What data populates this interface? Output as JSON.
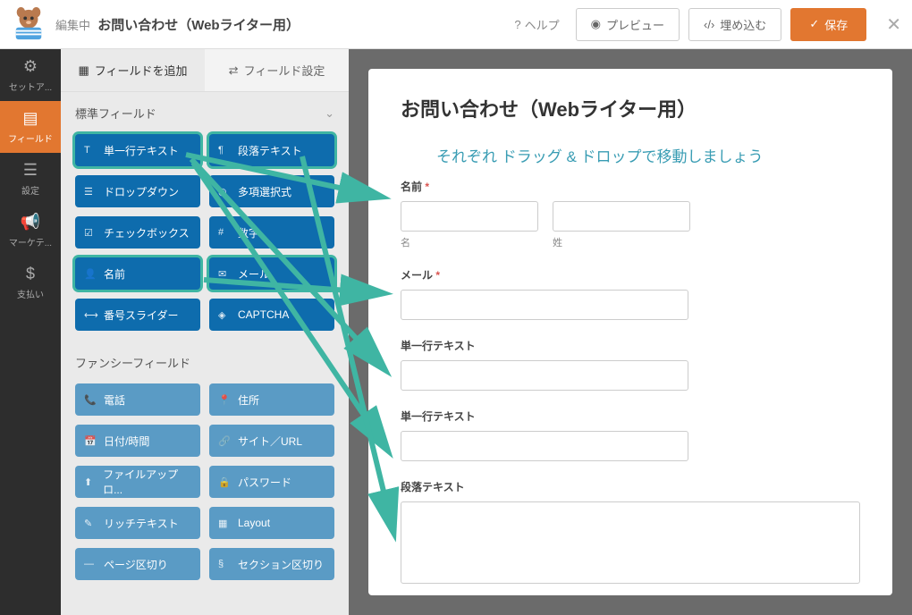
{
  "header": {
    "editing_label": "編集中",
    "form_name": "お問い合わせ（Webライター用）",
    "help": "ヘルプ",
    "preview": "プレビュー",
    "embed": "埋め込む",
    "save": "保存"
  },
  "nav": {
    "setup": "セットア...",
    "fields": "フィールド",
    "settings": "設定",
    "marketing": "マーケテ...",
    "payment": "支払い"
  },
  "panel": {
    "add_tab": "フィールドを追加",
    "settings_tab": "フィールド設定",
    "section_standard": "標準フィールド",
    "section_fancy": "ファンシーフィールド",
    "fields_standard": [
      {
        "label": "単一行テキスト",
        "highlighted": true
      },
      {
        "label": "段落テキスト",
        "highlighted": true
      },
      {
        "label": "ドロップダウン",
        "highlighted": false
      },
      {
        "label": "多項選択式",
        "highlighted": false
      },
      {
        "label": "チェックボックス",
        "highlighted": false
      },
      {
        "label": "数字",
        "highlighted": false
      },
      {
        "label": "名前",
        "highlighted": true
      },
      {
        "label": "メール",
        "highlighted": true
      },
      {
        "label": "番号スライダー",
        "highlighted": false
      },
      {
        "label": "CAPTCHA",
        "highlighted": false
      }
    ],
    "fields_fancy": [
      {
        "label": "電話"
      },
      {
        "label": "住所"
      },
      {
        "label": "日付/時間"
      },
      {
        "label": "サイト／URL"
      },
      {
        "label": "ファイルアップロ..."
      },
      {
        "label": "パスワード"
      },
      {
        "label": "リッチテキスト"
      },
      {
        "label": "Layout"
      },
      {
        "label": "ページ区切り"
      },
      {
        "label": "セクション区切り"
      }
    ]
  },
  "preview": {
    "title": "お問い合わせ（Webライター用）",
    "annotation": "それぞれ ドラッグ & ドロップで移動しましょう",
    "name_label": "名前",
    "first_name": "名",
    "last_name": "姓",
    "email_label": "メール",
    "single_line": "単一行テキスト",
    "paragraph": "段落テキスト"
  }
}
